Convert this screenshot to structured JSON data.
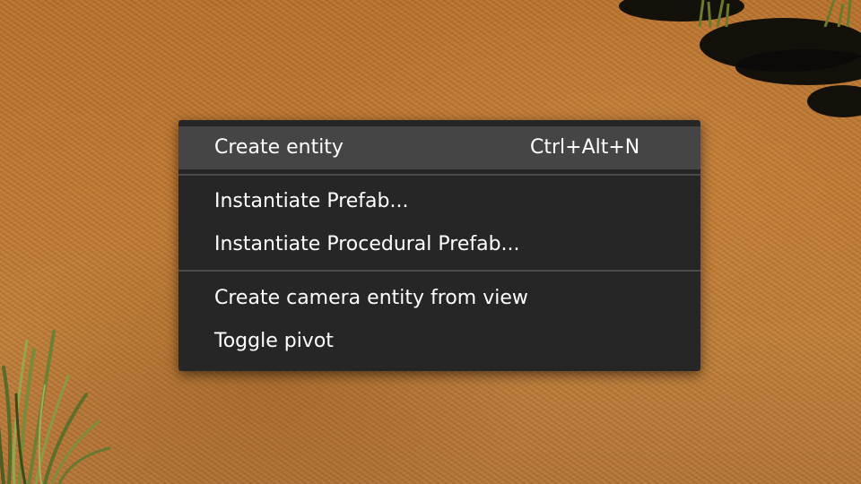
{
  "context_menu": {
    "items": [
      {
        "label": "Create entity",
        "shortcut": "Ctrl+Alt+N",
        "highlighted": true
      },
      {
        "label": "Instantiate Prefab..."
      },
      {
        "label": "Instantiate Procedural Prefab..."
      },
      {
        "label": "Create camera entity from view"
      },
      {
        "label": "Toggle pivot"
      }
    ]
  },
  "colors": {
    "menu_background": "#262626",
    "menu_highlight": "#454545",
    "separator": "#4a4a4a",
    "menu_text": "#ffffff",
    "terrain": "#bf7a35"
  }
}
